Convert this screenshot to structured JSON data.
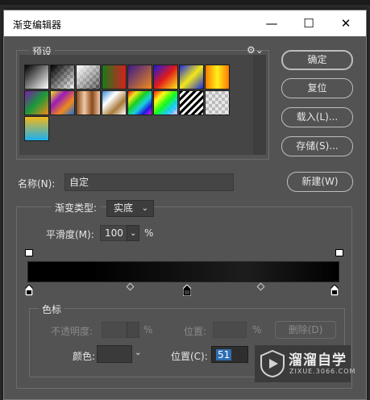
{
  "dialog": {
    "title": "渐变编辑器"
  },
  "window_controls": {
    "minimize": "—",
    "maximize": "☐",
    "close": "✕"
  },
  "presets": {
    "label": "预设",
    "gear": "⚙⌄",
    "swatches": [
      {
        "name": "black-white"
      },
      {
        "name": "black-transparent"
      },
      {
        "name": "white-transparent"
      },
      {
        "name": "green-red"
      },
      {
        "name": "violet-orange"
      },
      {
        "name": "blue-red-yellow"
      },
      {
        "name": "blue-yellow-blue"
      },
      {
        "name": "orange-yellow-orange"
      },
      {
        "name": "violet-green-orange"
      },
      {
        "name": "yellow-violet-orange-blue"
      },
      {
        "name": "copper"
      },
      {
        "name": "chrome"
      },
      {
        "name": "spectrum"
      },
      {
        "name": "transparent-rainbow"
      },
      {
        "name": "transparent-stripes"
      },
      {
        "name": "neutral-density"
      },
      {
        "name": "cyan-yellow"
      }
    ]
  },
  "buttons": {
    "ok": "确定",
    "reset": "复位",
    "load": "载入(L)...",
    "save": "存储(S)...",
    "new": "新建(W)"
  },
  "name_field": {
    "label": "名称(N):",
    "value": "自定"
  },
  "gradient_type": {
    "label": "渐变类型:",
    "value": "实底"
  },
  "smoothness": {
    "label": "平滑度(M):",
    "value": "100",
    "unit": "%"
  },
  "color_stops": {
    "group_label": "色标",
    "opacity_label": "不透明度:",
    "opacity_unit": "%",
    "opacity_position_label": "位置:",
    "opacity_position_unit": "%",
    "delete": "删除(D)",
    "color_label": "颜色:",
    "color_value": "#3a3a3a",
    "position_label": "位置(C):",
    "position_value": "51"
  },
  "watermark": {
    "brand": "溜溜自学",
    "url": "ZIXUE.3066.COM"
  },
  "colors": {
    "panel": "#535353",
    "text": "#d6d6d6",
    "accent": "#2e6fb3"
  }
}
